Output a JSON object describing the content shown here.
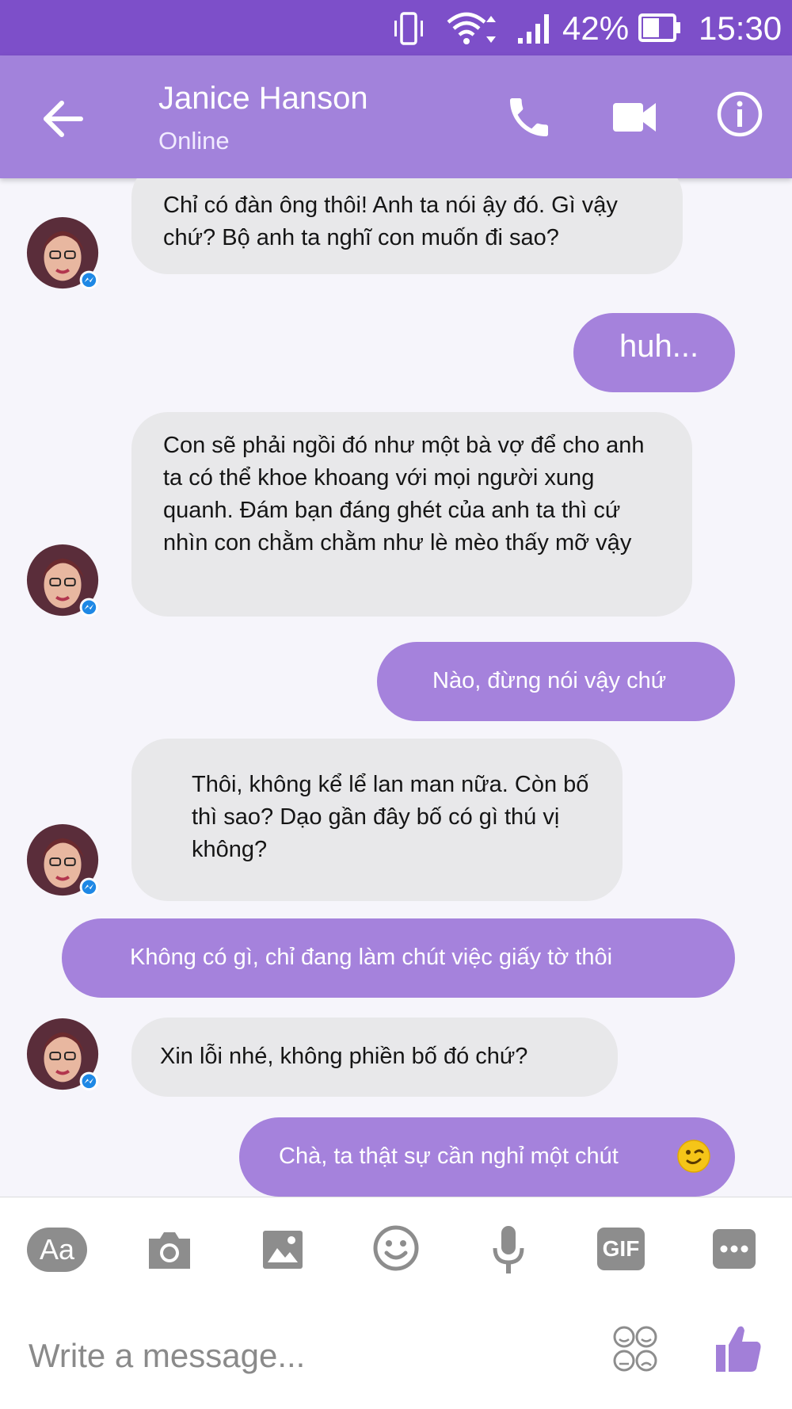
{
  "status_bar": {
    "battery_percent": "42%",
    "time": "15:30",
    "icons": [
      "vibrate-icon",
      "wifi-icon",
      "signal-icon",
      "battery-icon"
    ]
  },
  "header": {
    "contact_name": "Janice Hanson",
    "contact_status": "Online",
    "icons": [
      "back-arrow-icon",
      "phone-icon",
      "video-camera-icon",
      "info-icon"
    ]
  },
  "messages": [
    {
      "from": "contact",
      "text": "Chỉ có đàn ông thôi! Anh ta nói ậy đó. Gì vậy chứ? Bộ anh ta nghĩ con muốn đi sao?"
    },
    {
      "from": "me",
      "text": "huh..."
    },
    {
      "from": "contact",
      "text": "Con sẽ phải ngồi đó như một bà vợ để cho anh ta có thể khoe khoang với mọi người xung quanh. Đám bạn đáng ghét của anh ta thì cứ nhìn con chằm chằm như lè mèo thấy mỡ vậy"
    },
    {
      "from": "me",
      "text": "Nào, đừng nói vậy chứ"
    },
    {
      "from": "contact",
      "text": "Thôi, không kể lể lan man nữa. Còn bố thì sao? Dạo gần đây bố có gì thú vị không?"
    },
    {
      "from": "me",
      "text": "Không có gì, chỉ đang làm chút việc giấy tờ thôi"
    },
    {
      "from": "contact",
      "text": "Xin lỗi nhé, không phiền bố đó chứ?"
    },
    {
      "from": "me",
      "text": "Chà, ta thật sự cần nghỉ một chút",
      "emoji": "wink-emoji-icon"
    }
  ],
  "composer": {
    "tools": [
      {
        "name": "text-format-button",
        "label": "Aa"
      },
      {
        "name": "camera-button",
        "icon": "camera-icon"
      },
      {
        "name": "gallery-button",
        "icon": "image-icon"
      },
      {
        "name": "emoji-button",
        "icon": "smiley-icon"
      },
      {
        "name": "voice-button",
        "icon": "microphone-icon"
      },
      {
        "name": "gif-button",
        "label": "GIF"
      },
      {
        "name": "more-button",
        "icon": "more-dots-icon"
      }
    ],
    "placeholder": "Write a message...",
    "icons": [
      "sticker-icon",
      "thumbs-up-icon"
    ]
  },
  "colors": {
    "status_bar": "#7d4fc9",
    "header": "#a282db",
    "outgoing_bubble": "#a582dc",
    "incoming_bubble": "#e8e8ea",
    "background": "#f6f5fb",
    "tool_icon": "#8d8d8d",
    "like_icon": "#a27fd8"
  }
}
